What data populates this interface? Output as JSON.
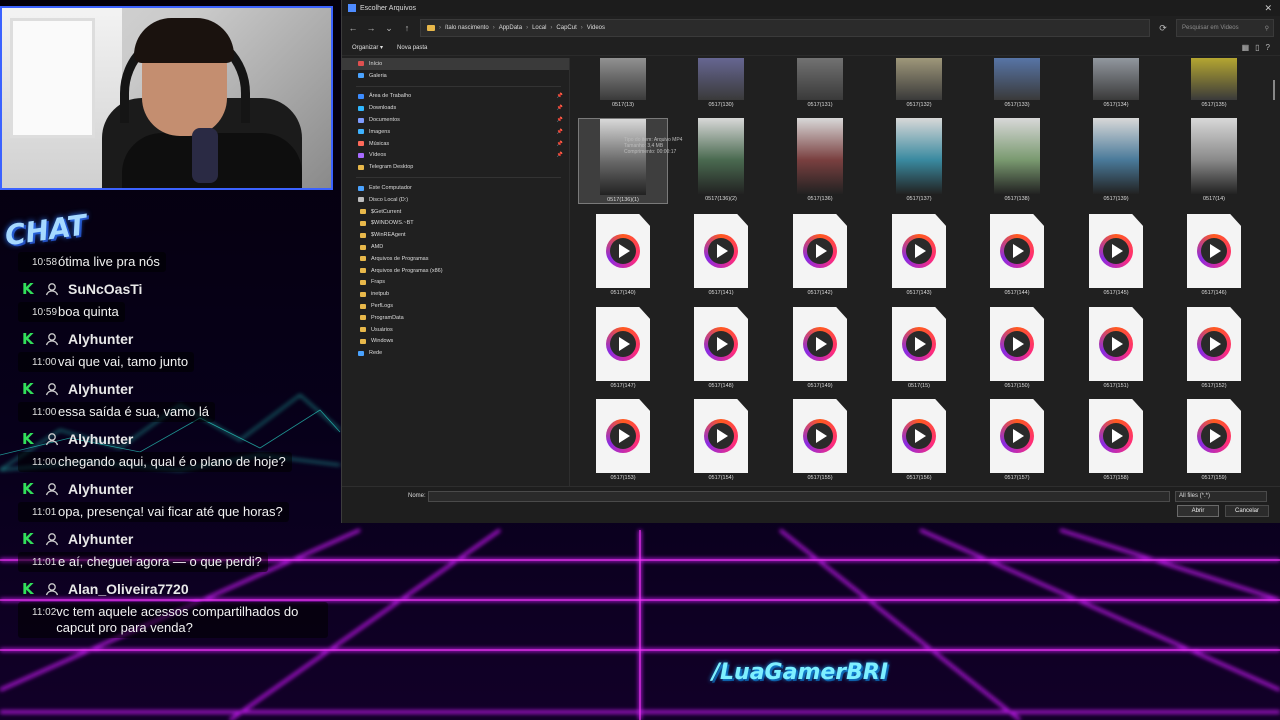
{
  "chat": {
    "logo_text": "CHAT",
    "messages": [
      {
        "time": "10:58",
        "text": "ótima live pra nós"
      },
      {
        "author": "SuNcOasTi",
        "time": "10:59",
        "text": "boa quinta"
      },
      {
        "author": "Alyhunter",
        "time": "11:00",
        "text": "vai que vai, tamo junto"
      },
      {
        "author": "Alyhunter",
        "time": "11:00",
        "text": "essa saída é sua, vamo lá"
      },
      {
        "author": "Alyhunter",
        "time": "11:00",
        "text": "chegando aqui, qual é o plano de hoje?"
      },
      {
        "author": "Alyhunter",
        "time": "11:01",
        "text": "opa, presença! vai ficar até que horas?"
      },
      {
        "author": "Alyhunter",
        "time": "11:01",
        "text": "e aí, cheguei agora — o que perdi?"
      },
      {
        "author": "Alan_Oliveira7720",
        "time": "11:02",
        "text": "vc tem aquele acessos compartilhados do capcut pro para venda?"
      }
    ]
  },
  "streamer_tag": "/LuaGamerBRI",
  "dialog": {
    "title": "Escolher Arquivos",
    "path": [
      "ítalo nascimento",
      "AppData",
      "Local",
      "CapCut",
      "Videos"
    ],
    "search_placeholder": "Pesquisar em Videos",
    "toolbar": {
      "organize": "Organizar ▾",
      "new_folder": "Nova pasta"
    },
    "nav": [
      {
        "label": "Início",
        "icon": "home-icon",
        "selected": true
      },
      {
        "label": "Galeria",
        "icon": "gallery-icon"
      },
      {
        "sep": true
      },
      {
        "label": "Área de Trabalho",
        "icon": "desktop-icon",
        "pin": true
      },
      {
        "label": "Downloads",
        "icon": "downloads-icon",
        "pin": true
      },
      {
        "label": "Documentos",
        "icon": "documents-icon",
        "pin": true
      },
      {
        "label": "Imagens",
        "icon": "images-icon",
        "pin": true
      },
      {
        "label": "Músicas",
        "icon": "music-icon",
        "pin": true
      },
      {
        "label": "Vídeos",
        "icon": "videos-icon",
        "pin": true
      },
      {
        "label": "Telegram Desktop",
        "icon": "folder-icon"
      },
      {
        "sep": true
      },
      {
        "label": "Este Computador",
        "icon": "computer-icon"
      },
      {
        "label": "Disco Local (D:)",
        "icon": "drive-icon"
      },
      {
        "label": "$GetCurrent",
        "icon": "folder-icon",
        "indent": true
      },
      {
        "label": "$WINDOWS.~BT",
        "icon": "folder-icon",
        "indent": true
      },
      {
        "label": "$WinREAgent",
        "icon": "folder-icon",
        "indent": true
      },
      {
        "label": "AMD",
        "icon": "folder-icon",
        "indent": true
      },
      {
        "label": "Arquivos de Programas",
        "icon": "folder-icon",
        "indent": true
      },
      {
        "label": "Arquivos de Programas (x86)",
        "icon": "folder-icon",
        "indent": true
      },
      {
        "label": "Fraps",
        "icon": "folder-icon",
        "indent": true
      },
      {
        "label": "inetpub",
        "icon": "folder-icon",
        "indent": true
      },
      {
        "label": "PerfLogs",
        "icon": "folder-icon",
        "indent": true
      },
      {
        "label": "ProgramData",
        "icon": "folder-icon",
        "indent": true
      },
      {
        "label": "Usuários",
        "icon": "folder-icon",
        "indent": true
      },
      {
        "label": "Windows",
        "icon": "folder-icon",
        "indent": true
      },
      {
        "label": "Rede",
        "icon": "network-icon"
      }
    ],
    "files": [
      [
        "0517(13)",
        "0517(130)",
        "0517(131)",
        "0517(132)",
        "0517(133)",
        "0517(134)",
        "0517(135)"
      ],
      [
        "0517(136)(1)",
        "0517(136)(2)",
        "0517(136)",
        "0517(137)",
        "0517(138)",
        "0517(139)",
        "0517(14)"
      ],
      [
        "0517(140)",
        "0517(141)",
        "0517(142)",
        "0517(143)",
        "0517(144)",
        "0517(145)",
        "0517(146)"
      ],
      [
        "0517(147)",
        "0517(148)",
        "0517(149)",
        "0517(15)",
        "0517(150)",
        "0517(151)",
        "0517(152)"
      ],
      [
        "0517(153)",
        "0517(154)",
        "0517(155)",
        "0517(156)",
        "0517(157)",
        "0517(158)",
        "0517(159)"
      ]
    ],
    "tooltip": [
      "Tipo do item: Arquivo MP4",
      "Tamanho: 3,4 MB",
      "Comprimento: 00:00:17"
    ],
    "name_label": "Nome:",
    "name_value": "",
    "filter": "All files (*.*)",
    "open": "Abrir",
    "cancel": "Cancelar"
  },
  "colors": {
    "neon_grid": "#d21cff",
    "chat_badge": "#32e05b",
    "webcam_border": "#3b62ff",
    "tag": "#7ef0ff"
  }
}
